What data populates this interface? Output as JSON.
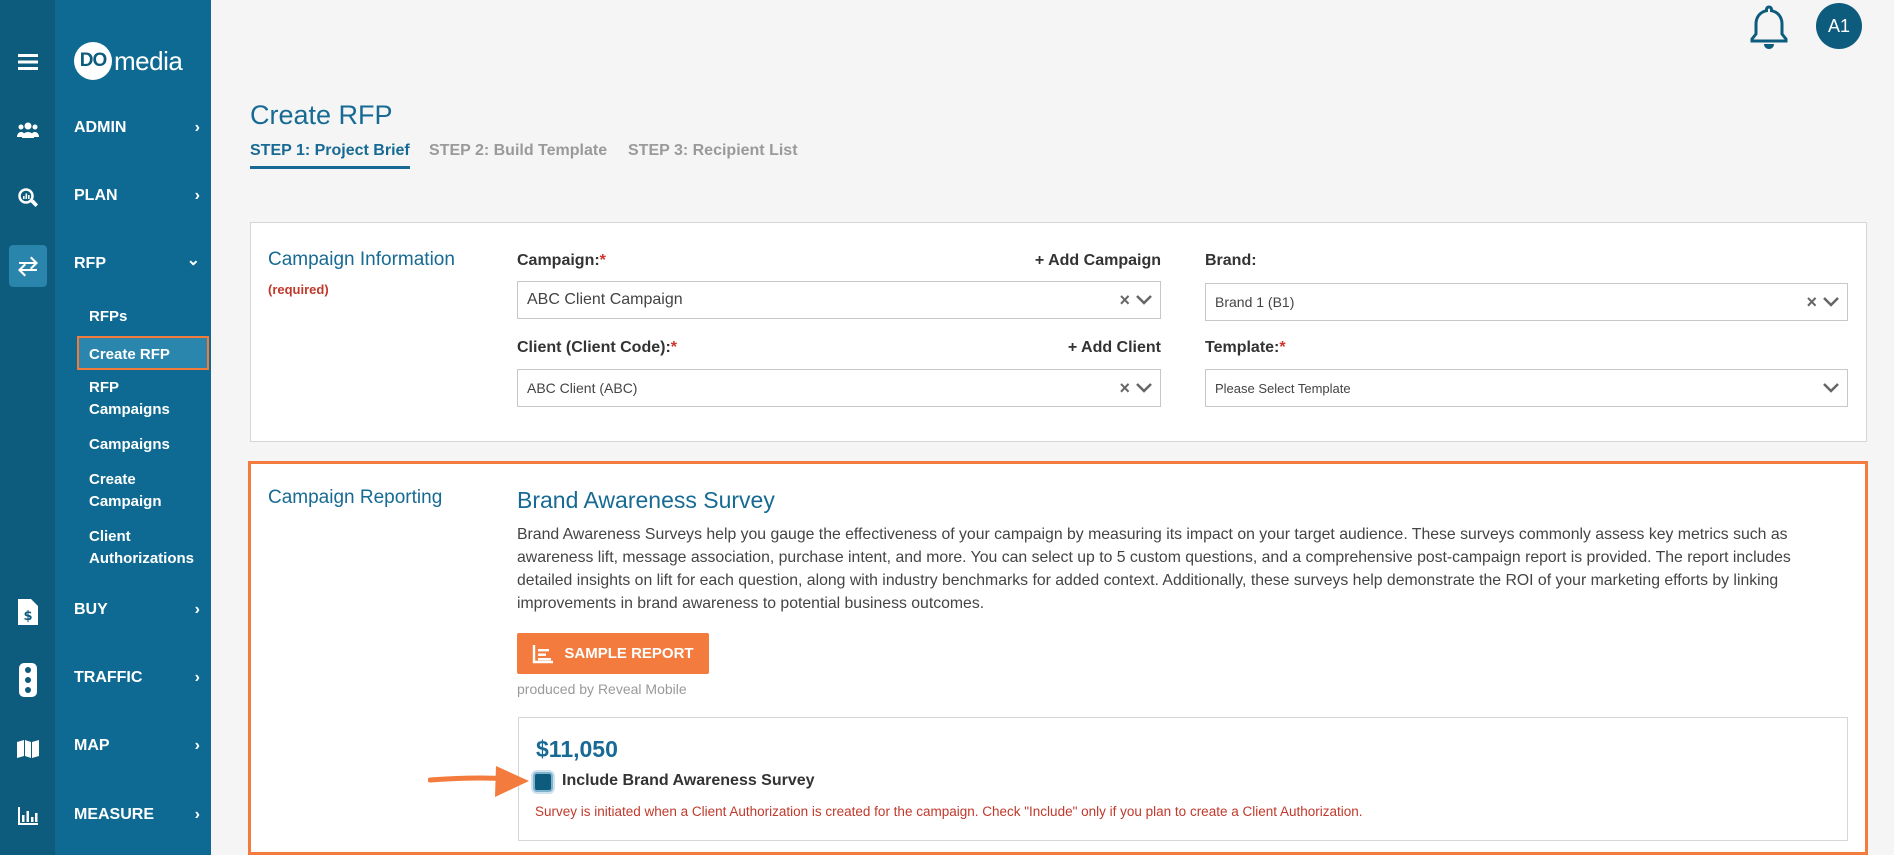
{
  "brand": {
    "logo_mark": "DO",
    "logo_text": "media"
  },
  "colors": {
    "sidebar_dark": "#0d5b7d",
    "sidebar": "#0e6a92",
    "accent": "#176a94",
    "highlight": "#f27b3d",
    "required": "#d0342c"
  },
  "sidebar": {
    "menu_icon": "hamburger-icon",
    "nav": [
      {
        "label": "ADMIN",
        "icon": "users-icon",
        "chevron": "›"
      },
      {
        "label": "PLAN",
        "icon": "search-chart-icon",
        "chevron": "›"
      },
      {
        "label": "RFP",
        "icon": "swap-arrows-icon",
        "chevron": "⌄"
      },
      {
        "label": "BUY",
        "icon": "invoice-dollar-icon",
        "chevron": "›"
      },
      {
        "label": "TRAFFIC",
        "icon": "traffic-light-icon",
        "chevron": "›"
      },
      {
        "label": "MAP",
        "icon": "map-icon",
        "chevron": "›"
      },
      {
        "label": "MEASURE",
        "icon": "bar-chart-icon",
        "chevron": "›"
      }
    ],
    "rfp_sub": {
      "rfps": "RFPs",
      "create_rfp": "Create RFP",
      "rfp_campaigns_1": "RFP",
      "rfp_campaigns_2": "Campaigns",
      "campaigns": "Campaigns",
      "create_campaign_1": "Create",
      "create_campaign_2": "Campaign",
      "client_auth_1": "Client",
      "client_auth_2": "Authorizations"
    }
  },
  "header": {
    "avatar": "A1",
    "bell_icon": "bell-icon"
  },
  "page": {
    "title": "Create RFP",
    "steps": [
      "STEP 1: Project Brief",
      "STEP 2: Build Template",
      "STEP 3: Recipient List"
    ]
  },
  "campaign_info": {
    "label": "Campaign Information",
    "required": "(required)",
    "campaign_label": "Campaign:",
    "add_campaign": "+ Add Campaign",
    "campaign_value": "ABC Client Campaign",
    "brand_label": "Brand:",
    "brand_value": "Brand 1 (B1)",
    "client_label": "Client (Client Code):",
    "add_client": "+ Add Client",
    "client_value": "ABC Client (ABC)",
    "template_label": "Template:",
    "template_placeholder": "Please Select Template",
    "star": "*",
    "clear": "×"
  },
  "campaign_reporting": {
    "label": "Campaign Reporting",
    "title": "Brand Awareness Survey",
    "description": "Brand Awareness Surveys help you gauge the effectiveness of your campaign by measuring its impact on your target audience. These surveys commonly assess key metrics such as awareness lift, message association, purchase intent, and more. You can select up to 5 custom questions, and a comprehensive post-campaign report is provided. The report includes detailed insights on lift for each question, along with industry benchmarks for added context. Additionally, these surveys help demonstrate the ROI of your marketing efforts by linking improvements in brand awareness to potential business outcomes.",
    "sample_button": "SAMPLE REPORT",
    "produced_by": "produced by Reveal Mobile",
    "price": "$11,050",
    "include_label": "Include Brand Awareness Survey",
    "notice": "Survey is initiated when a Client Authorization is created for the campaign. Check \"Include\" only if you plan to create a Client Authorization."
  }
}
